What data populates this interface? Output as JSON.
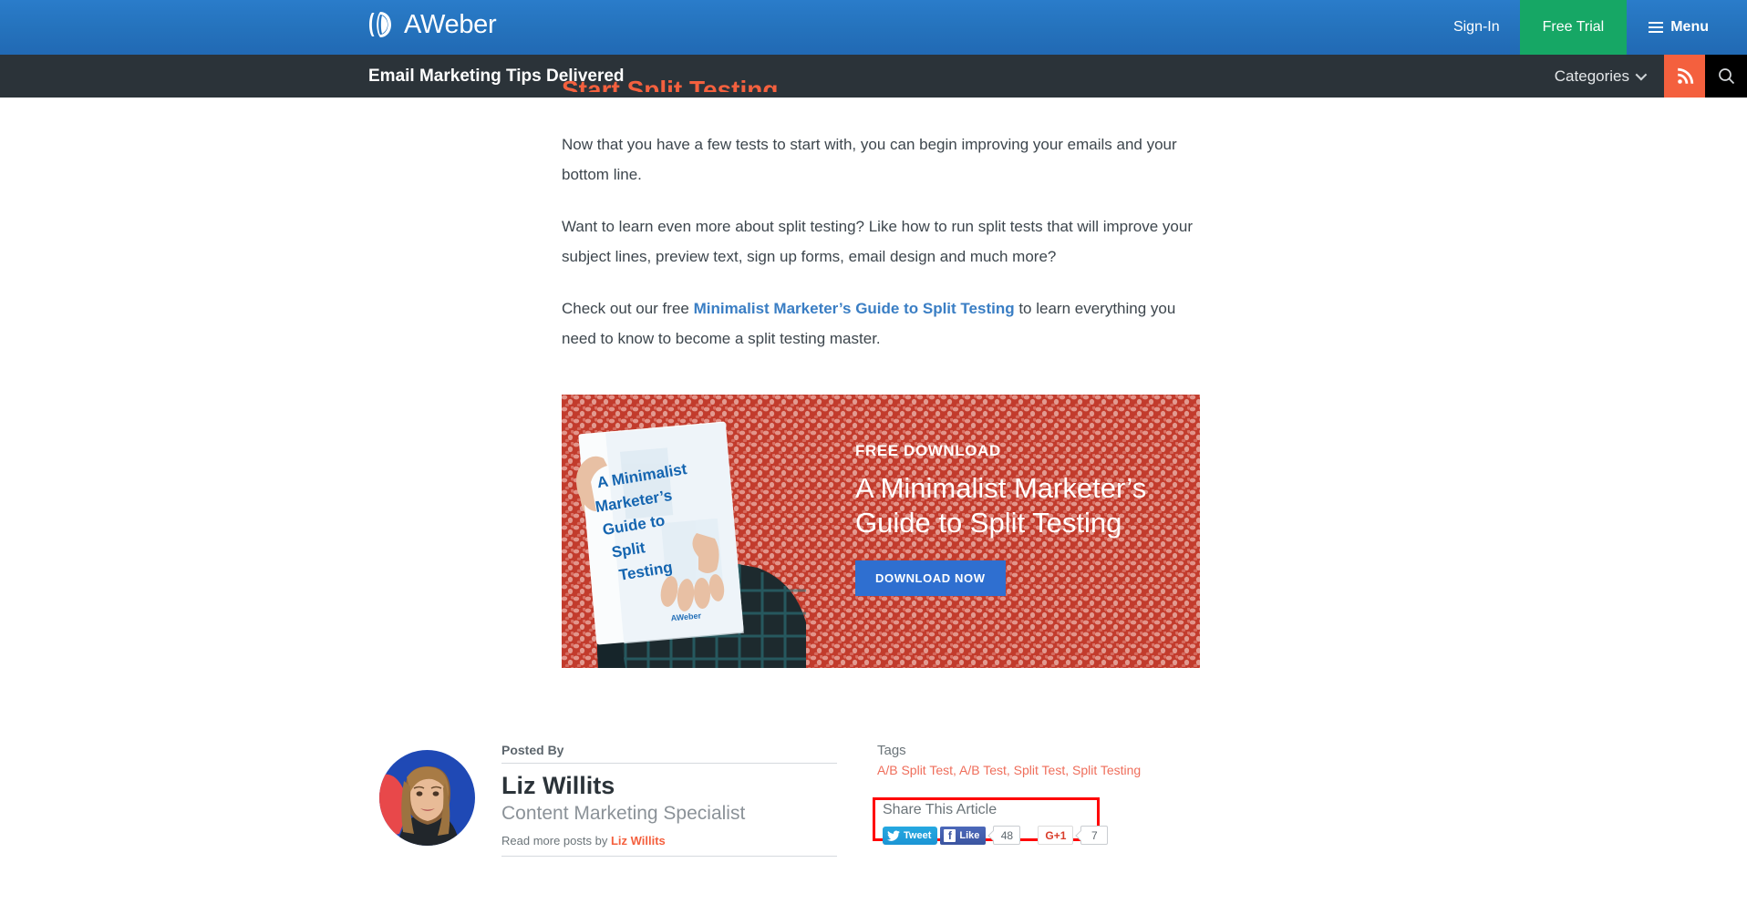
{
  "topbar": {
    "brand": "AWeber",
    "signin_label": "Sign-In",
    "free_trial_label": "Free Trial",
    "menu_label": "Menu",
    "bg_color": "#2573bd",
    "free_trial_color": "#16a765"
  },
  "subnav": {
    "title": "Email Marketing Tips Delivered",
    "categories_label": "Categories",
    "bg_color": "#2b3339",
    "rss_color": "#f4603e",
    "search_color": "#000000"
  },
  "article": {
    "cut_heading": "Start Split Testing",
    "paragraphs": [
      "Now that you have a few tests to start with, you can begin improving your emails and your bottom line.",
      "Want to learn even more about split testing? Like how to run split tests that will improve your subject lines, preview text, sign up forms, email design and much more?"
    ],
    "p3_before": "Check out our free ",
    "p3_link": "Minimalist Marketer’s Guide to Split Testing",
    "p3_after": " to learn everything you need to know to become a split testing master.",
    "link_color": "#3a7ec4"
  },
  "banner": {
    "kicker": "FREE DOWNLOAD",
    "title_line1": "A Minimalist Marketer’s",
    "title_line2": "Guide to Split Testing",
    "cta_label": "DOWNLOAD NOW",
    "book_line1": "A Minimalist",
    "book_line2": "Marketer’s",
    "book_line3": "Guide to",
    "book_line4": "Split",
    "book_line5": "Testing",
    "book_brand": "AWeber",
    "bg_color": "#c0392b",
    "cta_color": "#2f6fd0"
  },
  "author": {
    "posted_by_label": "Posted By",
    "name": "Liz Willits",
    "role": "Content Marketing Specialist",
    "read_more_prefix": "Read more posts by ",
    "read_more_link": "Liz Willits",
    "link_color": "#f4603e"
  },
  "side": {
    "tags_label": "Tags",
    "tags": [
      "A/B Split Test",
      "A/B Test",
      "Split Test",
      "Split Testing"
    ],
    "tags_text": "A/B Split Test, A/B Test, Split Test, Split Testing",
    "tags_color": "#ef6e5b",
    "share_label": "Share This Article",
    "highlight_color": "#ff0000",
    "tweet_label": "Tweet",
    "like_label": "Like",
    "facebook_glyph": "f",
    "facebook_count": "48",
    "gplus_label": "G+1",
    "gplus_count": "7"
  }
}
